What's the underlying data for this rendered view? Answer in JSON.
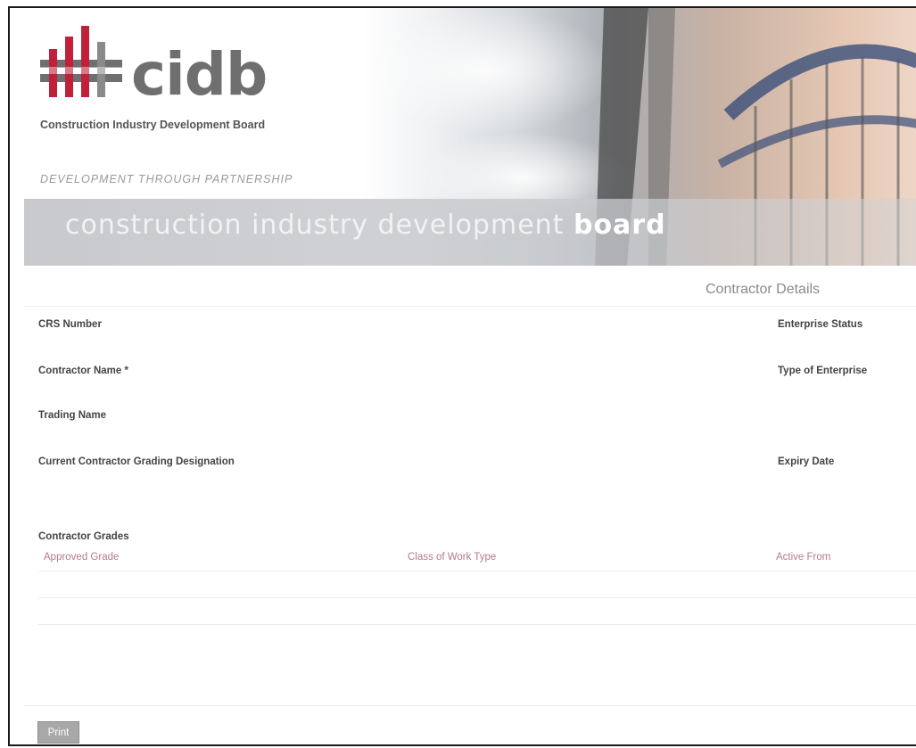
{
  "banner": {
    "logo_word": "cidb",
    "logo_subtitle": "Construction Industry Development Board",
    "tagline": "DEVELOPMENT THROUGH PARTNERSHIP",
    "band_text_light": "construction industry development ",
    "band_text_bold": "board",
    "colors": {
      "logo_red": "#c0203a",
      "logo_gray": "#6f6f6f"
    }
  },
  "form": {
    "section_title": "Contractor Details",
    "left_fields": [
      "CRS Number",
      "Contractor Name *",
      "Trading Name",
      "Current Contractor Grading Designation"
    ],
    "right_fields": [
      "Enterprise Status",
      "Type of Enterprise",
      "Expiry Date"
    ],
    "grades_heading": "Contractor Grades",
    "table": {
      "columns": [
        "Approved Grade",
        "Class of Work Type",
        "Active From"
      ],
      "header_color": "#b57a87"
    }
  },
  "actions": {
    "print_label": "Print"
  }
}
